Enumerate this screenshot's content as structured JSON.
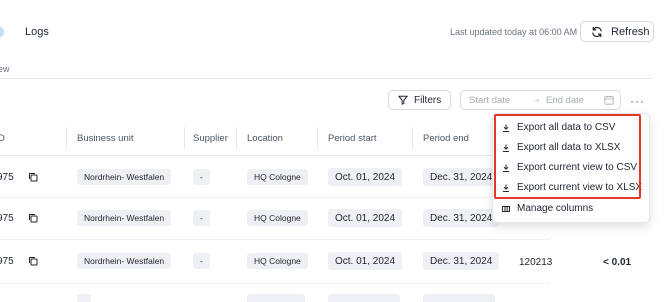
{
  "tabs": {
    "logs_label": "Logs"
  },
  "header": {
    "last_updated": "Last updated today at 06:00 AM",
    "refresh_label": "Refresh",
    "view_link": "ew"
  },
  "toolbar": {
    "filters_label": "Filters",
    "date_start_placeholder": "Start date",
    "date_end_placeholder": "End date",
    "date_arrow": "→",
    "more_label": "···"
  },
  "table": {
    "columns": [
      "D",
      "Business unit",
      "Supplier",
      "Location",
      "Period start",
      "Period end"
    ],
    "rows": [
      {
        "id": "975",
        "business_unit": "Nordrhein- Westfalen",
        "supplier": "-",
        "location": "HQ Cologne",
        "period_start": "Oct. 01, 2024",
        "period_end": "Dec. 31, 2024",
        "number": "",
        "value": ""
      },
      {
        "id": "975",
        "business_unit": "Nordrhein- Westfalen",
        "supplier": "-",
        "location": "HQ Cologne",
        "period_start": "Oct. 01, 2024",
        "period_end": "Dec. 31, 2024",
        "number": "",
        "value": ""
      },
      {
        "id": "975",
        "business_unit": "Nordrhein- Westfalen",
        "supplier": "-",
        "location": "HQ Cologne",
        "period_start": "Oct. 01, 2024",
        "period_end": "Dec. 31, 2024",
        "number": "120213",
        "value": "< 0.01"
      }
    ]
  },
  "menu": {
    "items": [
      {
        "label": "Export all data to CSV",
        "icon": "download-icon"
      },
      {
        "label": "Export all data to XLSX",
        "icon": "download-icon"
      },
      {
        "label": "Export current view to CSV",
        "icon": "download-icon"
      },
      {
        "label": "Export current view to XLSX",
        "icon": "download-icon"
      },
      {
        "label": "Manage columns",
        "icon": "columns-icon"
      }
    ],
    "highlight_color": "#e3372a"
  }
}
